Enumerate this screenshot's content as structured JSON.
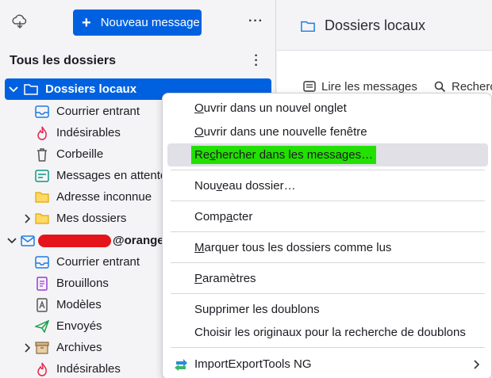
{
  "toolbar": {
    "new_message_label": "Nouveau message",
    "more_label": "···"
  },
  "folder_pane": {
    "header_title": "Tous les dossiers",
    "local_folders": {
      "label": "Dossiers locaux",
      "children": [
        {
          "label": "Courrier entrant",
          "icon": "inbox-icon"
        },
        {
          "label": "Indésirables",
          "icon": "junk-flame-icon"
        },
        {
          "label": "Corbeille",
          "icon": "trash-icon"
        },
        {
          "label": "Messages en attente",
          "icon": "outbox-icon"
        },
        {
          "label": "Adresse inconnue",
          "icon": "folder-icon"
        },
        {
          "label": "Mes dossiers",
          "icon": "folder-icon"
        }
      ]
    },
    "account": {
      "label_suffix": "@orange.f",
      "children": [
        {
          "label": "Courrier entrant",
          "icon": "inbox-icon"
        },
        {
          "label": "Brouillons",
          "icon": "drafts-icon"
        },
        {
          "label": "Modèles",
          "icon": "templates-icon"
        },
        {
          "label": "Envoyés",
          "icon": "sent-icon"
        },
        {
          "label": "Archives",
          "icon": "archive-icon"
        },
        {
          "label": "Indésirables",
          "icon": "junk-flame-icon"
        }
      ]
    }
  },
  "right_pane": {
    "title": "Dossiers locaux",
    "read_messages_label": "Lire les messages",
    "search_label": "Recherch"
  },
  "context_menu": {
    "open_new_tab": {
      "pre": "",
      "key": "O",
      "post": "uvrir dans un nouvel onglet"
    },
    "open_new_window": {
      "pre": "",
      "key": "O",
      "post": "uvrir dans une nouvelle fenêtre"
    },
    "search_messages": {
      "pre": "Re",
      "key": "c",
      "post": "hercher dans les messages…"
    },
    "new_folder": {
      "pre": "Nou",
      "key": "v",
      "post": "eau dossier…"
    },
    "compact": {
      "pre": "Comp",
      "key": "a",
      "post": "cter"
    },
    "mark_all_read": {
      "pre": "",
      "key": "M",
      "post": "arquer tous les dossiers comme lus"
    },
    "settings": {
      "pre": "",
      "key": "P",
      "post": "aramètres"
    },
    "remove_duplicates": "Supprimer les doublons",
    "choose_originals": "Choisir les originaux pour la recherche de doublons",
    "import_export": "ImportExportTools NG"
  },
  "colors": {
    "accent": "#0061e0",
    "highlight": "#22e000",
    "redaction": "#e5141b"
  }
}
